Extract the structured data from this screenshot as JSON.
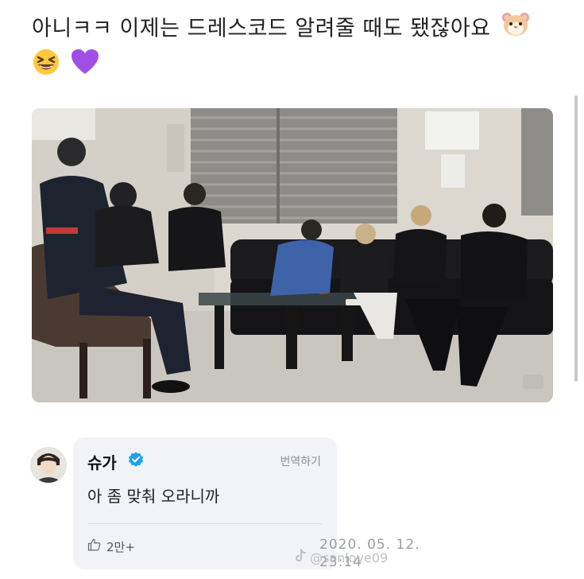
{
  "post": {
    "text": "아니ㅋㅋ 이제는 드레스코드 알려줄 때도 됐잖아요"
  },
  "icons": {
    "post_emojis": [
      "hamster-face-icon",
      "grinning-squinting-face-icon",
      "purple-heart-icon"
    ],
    "verified": "verified-badge-icon",
    "like": "thumbs-up-icon",
    "watermark": "tiktok-icon"
  },
  "colors": {
    "verified_blue": "#1da1f2",
    "bubble_bg": "#f1f3f8",
    "purple_heart": "#a14ee6"
  },
  "reply": {
    "author": "슈가",
    "translate_label": "번역하기",
    "comment": "아 좀 맞춰 오라니까",
    "likes": "2만+"
  },
  "meta": {
    "timestamp_date": "2020. 05. 12.",
    "timestamp_time": "23:14",
    "watermark": "@sanlove09"
  }
}
